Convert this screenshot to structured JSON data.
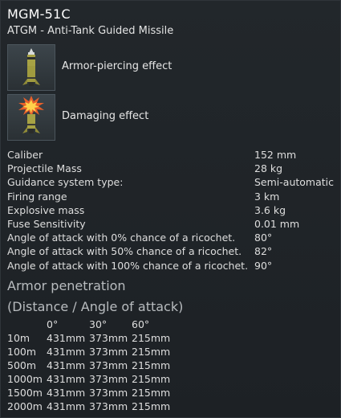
{
  "title": "MGM-51C",
  "subtitle": "ATGM - Anti-Tank Guided Missile",
  "effects": [
    {
      "label": "Armor-piercing effect",
      "icon": "armor-piercing-missile-icon"
    },
    {
      "label": "Damaging effect",
      "icon": "damaging-explosion-missile-icon"
    }
  ],
  "specs": [
    {
      "name": "Caliber",
      "value": "152 mm"
    },
    {
      "name": "Projectile Mass",
      "value": "28 kg"
    },
    {
      "name": "Guidance system type:",
      "value": "Semi-automatic"
    },
    {
      "name": "Firing range",
      "value": "3 km"
    },
    {
      "name": "Explosive mass",
      "value": "3.6 kg"
    },
    {
      "name": "Fuse Sensitivity",
      "value": "0.01 mm"
    },
    {
      "name": "Angle of attack with 0% chance of a ricochet.",
      "value": "80°"
    },
    {
      "name": "Angle of attack with 50% chance of a ricochet.",
      "value": "82°"
    },
    {
      "name": "Angle of attack with 100% chance of a ricochet.",
      "value": "90°"
    }
  ],
  "penetration": {
    "heading": "Armor penetration",
    "subheading": "(Distance / Angle of attack)",
    "angles": [
      "0°",
      "30°",
      "60°"
    ],
    "rows": [
      {
        "distance": "10m",
        "values": [
          "431mm",
          "373mm",
          "215mm"
        ]
      },
      {
        "distance": "100m",
        "values": [
          "431mm",
          "373mm",
          "215mm"
        ]
      },
      {
        "distance": "500m",
        "values": [
          "431mm",
          "373mm",
          "215mm"
        ]
      },
      {
        "distance": "1000m",
        "values": [
          "431mm",
          "373mm",
          "215mm"
        ]
      },
      {
        "distance": "1500m",
        "values": [
          "431mm",
          "373mm",
          "215mm"
        ]
      },
      {
        "distance": "2000m",
        "values": [
          "431mm",
          "373mm",
          "215mm"
        ]
      }
    ]
  },
  "colors": {
    "background": "#1f2327",
    "text": "#e2e2e2",
    "heading": "#b8bcbf",
    "missile_body": "#a7a244",
    "explosion": "#e8602a"
  }
}
